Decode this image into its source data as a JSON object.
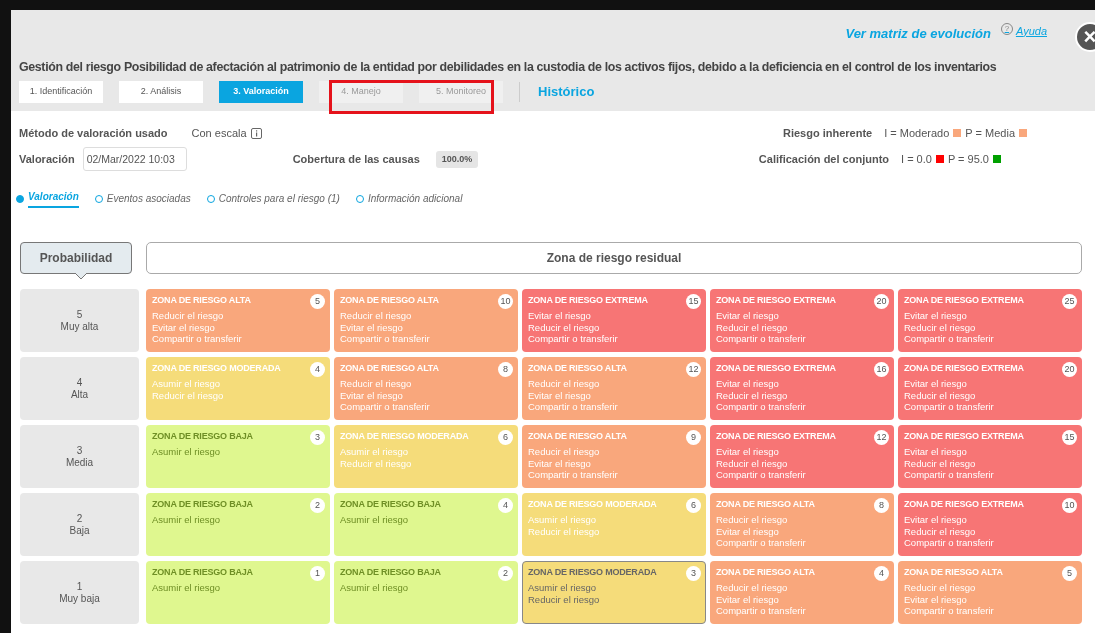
{
  "header": {
    "link": "Ver matriz de evolución",
    "help_icon": "?",
    "help": "Ayuda",
    "close": "×",
    "title": "Gestión del riesgo Posibilidad de afectación al patrimonio de la entidad por debilidades en la custodia de los activos fijos, debido a la deficiencia en el control de los inventarios"
  },
  "steps": [
    {
      "label": "1. Identificación",
      "selected": false,
      "disabled": false
    },
    {
      "label": "2. Análisis",
      "selected": false,
      "disabled": false
    },
    {
      "label": "3. Valoración",
      "selected": true,
      "disabled": false
    },
    {
      "label": "4. Manejo",
      "selected": false,
      "disabled": true
    },
    {
      "label": "5. Monitoreo",
      "selected": false,
      "disabled": true
    }
  ],
  "history": "Histórico",
  "info": {
    "method_label": "Método de valoración usado",
    "method_value": "Con escala",
    "date_label": "Valoración",
    "date_value": "02/Mar/2022 10:03",
    "coverage_label": "Cobertura de las causas",
    "coverage_value": "100.0%",
    "inherent_label": "Riesgo inherente",
    "inherent": [
      {
        "text": "I = Moderado",
        "color": "#f9a77c"
      },
      {
        "text": "P = Media",
        "color": "#f9a77c"
      }
    ],
    "rating_label": "Calificación del conjunto",
    "rating": [
      {
        "text": "I = 0.0",
        "color": "#ff0000"
      },
      {
        "text": "P = 95.0",
        "color": "#00a000"
      }
    ]
  },
  "subtabs": [
    {
      "label": "Valoración",
      "selected": true
    },
    {
      "label": "Eventos asociadas",
      "selected": false
    },
    {
      "label": "Controles para el riesgo (1)",
      "selected": false
    },
    {
      "label": "Información adicional",
      "selected": false
    }
  ],
  "matrix": {
    "row_header": "Probabilidad",
    "zone_header": "Zona de riesgo residual",
    "rows": [
      {
        "level": "5",
        "name": "Muy alta",
        "cells": [
          {
            "kind": "alta",
            "title": "ZONA DE RIESGO ALTA",
            "score": "5",
            "actions": [
              "Reducir el riesgo",
              "Evitar el riesgo",
              "Compartir o transferir"
            ],
            "selected": false
          },
          {
            "kind": "alta",
            "title": "ZONA DE RIESGO ALTA",
            "score": "10",
            "actions": [
              "Reducir el riesgo",
              "Evitar el riesgo",
              "Compartir o transferir"
            ],
            "selected": false
          },
          {
            "kind": "extrema",
            "title": "ZONA DE RIESGO EXTREMA",
            "score": "15",
            "actions": [
              "Evitar el riesgo",
              "Reducir el riesgo",
              "Compartir o transferir"
            ],
            "selected": false
          },
          {
            "kind": "extrema",
            "title": "ZONA DE RIESGO EXTREMA",
            "score": "20",
            "actions": [
              "Evitar el riesgo",
              "Reducir el riesgo",
              "Compartir o transferir"
            ],
            "selected": false
          },
          {
            "kind": "extrema",
            "title": "ZONA DE RIESGO EXTREMA",
            "score": "25",
            "actions": [
              "Evitar el riesgo",
              "Reducir el riesgo",
              "Compartir o transferir"
            ],
            "selected": false
          }
        ]
      },
      {
        "level": "4",
        "name": "Alta",
        "cells": [
          {
            "kind": "moderada",
            "title": "ZONA DE RIESGO MODERADA",
            "score": "4",
            "actions": [
              "Asumir el riesgo",
              "Reducir el riesgo"
            ],
            "selected": false
          },
          {
            "kind": "alta",
            "title": "ZONA DE RIESGO ALTA",
            "score": "8",
            "actions": [
              "Reducir el riesgo",
              "Evitar el riesgo",
              "Compartir o transferir"
            ],
            "selected": false
          },
          {
            "kind": "alta",
            "title": "ZONA DE RIESGO ALTA",
            "score": "12",
            "actions": [
              "Reducir el riesgo",
              "Evitar el riesgo",
              "Compartir o transferir"
            ],
            "selected": false
          },
          {
            "kind": "extrema",
            "title": "ZONA DE RIESGO EXTREMA",
            "score": "16",
            "actions": [
              "Evitar el riesgo",
              "Reducir el riesgo",
              "Compartir o transferir"
            ],
            "selected": false
          },
          {
            "kind": "extrema",
            "title": "ZONA DE RIESGO EXTREMA",
            "score": "20",
            "actions": [
              "Evitar el riesgo",
              "Reducir el riesgo",
              "Compartir o transferir"
            ],
            "selected": false
          }
        ]
      },
      {
        "level": "3",
        "name": "Media",
        "cells": [
          {
            "kind": "baja",
            "title": "ZONA DE RIESGO BAJA",
            "score": "3",
            "actions": [
              "Asumir el riesgo"
            ],
            "selected": false
          },
          {
            "kind": "moderada",
            "title": "ZONA DE RIESGO MODERADA",
            "score": "6",
            "actions": [
              "Asumir el riesgo",
              "Reducir el riesgo"
            ],
            "selected": false
          },
          {
            "kind": "alta",
            "title": "ZONA DE RIESGO ALTA",
            "score": "9",
            "actions": [
              "Reducir el riesgo",
              "Evitar el riesgo",
              "Compartir o transferir"
            ],
            "selected": false
          },
          {
            "kind": "extrema",
            "title": "ZONA DE RIESGO EXTREMA",
            "score": "12",
            "actions": [
              "Evitar el riesgo",
              "Reducir el riesgo",
              "Compartir o transferir"
            ],
            "selected": false
          },
          {
            "kind": "extrema",
            "title": "ZONA DE RIESGO EXTREMA",
            "score": "15",
            "actions": [
              "Evitar el riesgo",
              "Reducir el riesgo",
              "Compartir o transferir"
            ],
            "selected": false
          }
        ]
      },
      {
        "level": "2",
        "name": "Baja",
        "cells": [
          {
            "kind": "baja",
            "title": "ZONA DE RIESGO BAJA",
            "score": "2",
            "actions": [
              "Asumir el riesgo"
            ],
            "selected": false
          },
          {
            "kind": "baja",
            "title": "ZONA DE RIESGO BAJA",
            "score": "4",
            "actions": [
              "Asumir el riesgo"
            ],
            "selected": false
          },
          {
            "kind": "moderada",
            "title": "ZONA DE RIESGO MODERADA",
            "score": "6",
            "actions": [
              "Asumir el riesgo",
              "Reducir el riesgo"
            ],
            "selected": false
          },
          {
            "kind": "alta",
            "title": "ZONA DE RIESGO ALTA",
            "score": "8",
            "actions": [
              "Reducir el riesgo",
              "Evitar el riesgo",
              "Compartir o transferir"
            ],
            "selected": false
          },
          {
            "kind": "extrema",
            "title": "ZONA DE RIESGO EXTREMA",
            "score": "10",
            "actions": [
              "Evitar el riesgo",
              "Reducir el riesgo",
              "Compartir o transferir"
            ],
            "selected": false
          }
        ]
      },
      {
        "level": "1",
        "name": "Muy baja",
        "cells": [
          {
            "kind": "baja",
            "title": "ZONA DE RIESGO BAJA",
            "score": "1",
            "actions": [
              "Asumir el riesgo"
            ],
            "selected": false
          },
          {
            "kind": "baja",
            "title": "ZONA DE RIESGO BAJA",
            "score": "2",
            "actions": [
              "Asumir el riesgo"
            ],
            "selected": false
          },
          {
            "kind": "moderada",
            "title": "ZONA DE RIESGO MODERADA",
            "score": "3",
            "actions": [
              "Asumir el riesgo",
              "Reducir el riesgo"
            ],
            "selected": true
          },
          {
            "kind": "alta",
            "title": "ZONA DE RIESGO ALTA",
            "score": "4",
            "actions": [
              "Reducir el riesgo",
              "Evitar el riesgo",
              "Compartir o transferir"
            ],
            "selected": false
          },
          {
            "kind": "alta",
            "title": "ZONA DE RIESGO ALTA",
            "score": "5",
            "actions": [
              "Reducir el riesgo",
              "Evitar el riesgo",
              "Compartir o transferir"
            ],
            "selected": false
          }
        ]
      }
    ]
  }
}
